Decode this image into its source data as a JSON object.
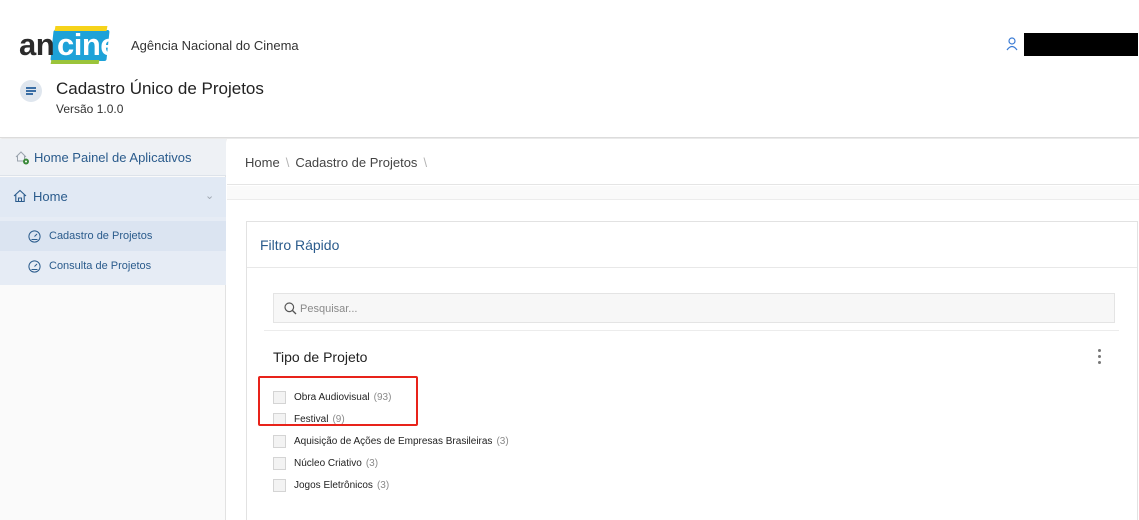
{
  "header": {
    "logo_an": "an",
    "logo_cine": "cine",
    "agency": "Agência Nacional do Cinema",
    "app_title": "Cadastro Único de Projetos",
    "version": "Versão 1.0.0",
    "user_icon": "user-icon"
  },
  "sidebar": {
    "painel_label": "Home Painel de Aplicativos",
    "home_label": "Home",
    "items": [
      {
        "label": "Cadastro de Projetos",
        "icon": "gauge-icon",
        "active": true
      },
      {
        "label": "Consulta de Projetos",
        "icon": "gauge-icon",
        "active": false
      }
    ]
  },
  "breadcrumb": {
    "items": [
      "Home",
      "Cadastro de Projetos"
    ],
    "separator": "\\"
  },
  "panel": {
    "title": "Filtro Rápido",
    "search_placeholder": "Pesquisar...",
    "group_title": "Tipo de Projeto",
    "options": [
      {
        "label": "Obra Audiovisual",
        "count": "(93)"
      },
      {
        "label": "Festival",
        "count": "(9)"
      },
      {
        "label": "Aquisição de Ações de Empresas Brasileiras",
        "count": "(3)"
      },
      {
        "label": "Núcleo Criativo",
        "count": "(3)"
      },
      {
        "label": "Jogos Eletrônicos",
        "count": "(3)"
      }
    ]
  },
  "colors": {
    "accent": "#2a5b8c",
    "logo_blue": "#1ea2d8",
    "highlight": "#e8231a"
  }
}
